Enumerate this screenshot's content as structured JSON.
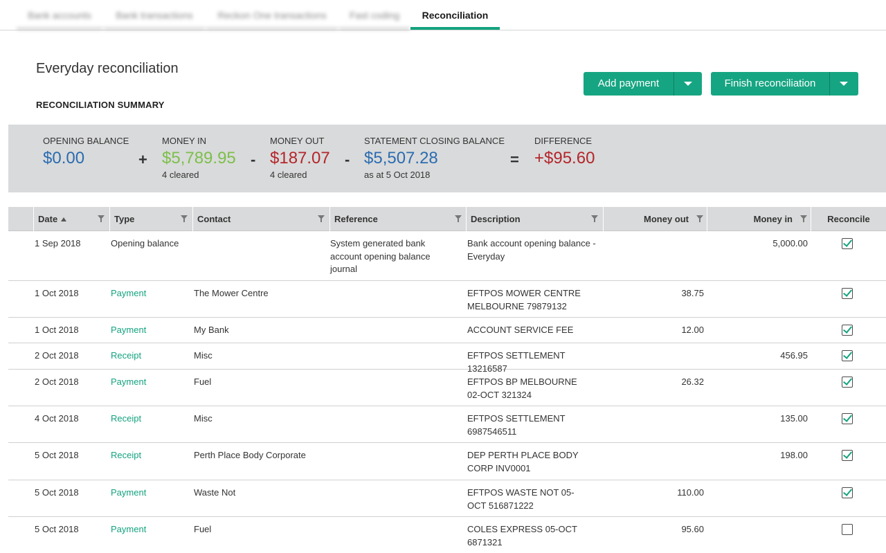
{
  "tabs": [
    {
      "label": "Bank accounts",
      "active": false
    },
    {
      "label": "Bank transactions",
      "active": false
    },
    {
      "label": "Reckon One transactions",
      "active": false
    },
    {
      "label": "Fast coding",
      "active": false
    },
    {
      "label": "Reconciliation",
      "active": true
    }
  ],
  "page_title": "Everyday reconciliation",
  "section_title": "RECONCILIATION SUMMARY",
  "buttons": {
    "add_payment": "Add payment",
    "finish_reconciliation": "Finish reconciliation"
  },
  "summary": {
    "opening_balance": {
      "label": "OPENING BALANCE",
      "value": "$0.00"
    },
    "money_in": {
      "label": "MONEY IN",
      "value": "$5,789.95",
      "sub": "4 cleared"
    },
    "money_out": {
      "label": "MONEY OUT",
      "value": "$187.07",
      "sub": "4 cleared"
    },
    "closing_balance": {
      "label": "STATEMENT CLOSING BALANCE",
      "value": "$5,507.28",
      "sub": "as at 5 Oct 2018"
    },
    "difference": {
      "label": "DIFFERENCE",
      "value": "+$95.60"
    },
    "ops": {
      "plus": "+",
      "minus1": "-",
      "minus2": "-",
      "equals": "="
    }
  },
  "table": {
    "columns": {
      "date": "Date",
      "type": "Type",
      "contact": "Contact",
      "reference": "Reference",
      "description": "Description",
      "money_out": "Money out",
      "money_in": "Money in",
      "reconcile": "Reconcile"
    },
    "rows": [
      {
        "date": "1 Sep 2018",
        "type": "Opening balance",
        "type_link": false,
        "contact": "",
        "reference": "System generated bank account opening balance journal",
        "description": "Bank account opening balance - Everyday",
        "money_out": "",
        "money_in": "5,000.00",
        "reconciled": true
      },
      {
        "date": "1 Oct 2018",
        "type": "Payment",
        "type_link": true,
        "contact": "The Mower Centre",
        "reference": "",
        "description": "EFTPOS MOWER CENTRE MELBOURNE 79879132",
        "money_out": "38.75",
        "money_in": "",
        "reconciled": true
      },
      {
        "date": "1 Oct 2018",
        "type": "Payment",
        "type_link": true,
        "contact": "My Bank",
        "reference": "",
        "description": "ACCOUNT SERVICE FEE",
        "money_out": "12.00",
        "money_in": "",
        "reconciled": true
      },
      {
        "date": "2 Oct 2018",
        "type": "Receipt",
        "type_link": true,
        "contact": "Misc",
        "reference": "",
        "description": "EFTPOS SETTLEMENT 13216587",
        "money_out": "",
        "money_in": "456.95",
        "reconciled": true
      },
      {
        "date": "2 Oct 2018",
        "type": "Payment",
        "type_link": true,
        "contact": "Fuel",
        "reference": "",
        "description": "EFTPOS BP MELBOURNE 02-OCT 321324",
        "money_out": "26.32",
        "money_in": "",
        "reconciled": true
      },
      {
        "date": "4 Oct 2018",
        "type": "Receipt",
        "type_link": true,
        "contact": "Misc",
        "reference": "",
        "description": "EFTPOS SETTLEMENT 6987546511",
        "money_out": "",
        "money_in": "135.00",
        "reconciled": true
      },
      {
        "date": "5 Oct 2018",
        "type": "Receipt",
        "type_link": true,
        "contact": "Perth Place Body Corporate",
        "reference": "",
        "description": "DEP PERTH PLACE BODY CORP INV0001",
        "money_out": "",
        "money_in": "198.00",
        "reconciled": true
      },
      {
        "date": "5 Oct 2018",
        "type": "Payment",
        "type_link": true,
        "contact": "Waste Not",
        "reference": "",
        "description": "EFTPOS WASTE NOT 05-OCT 516871222",
        "money_out": "110.00",
        "money_in": "",
        "reconciled": true
      },
      {
        "date": "5 Oct 2018",
        "type": "Payment",
        "type_link": true,
        "contact": "Fuel",
        "reference": "",
        "description": "COLES EXPRESS 05-OCT 6871321",
        "money_out": "95.60",
        "money_in": "",
        "reconciled": false
      }
    ]
  }
}
